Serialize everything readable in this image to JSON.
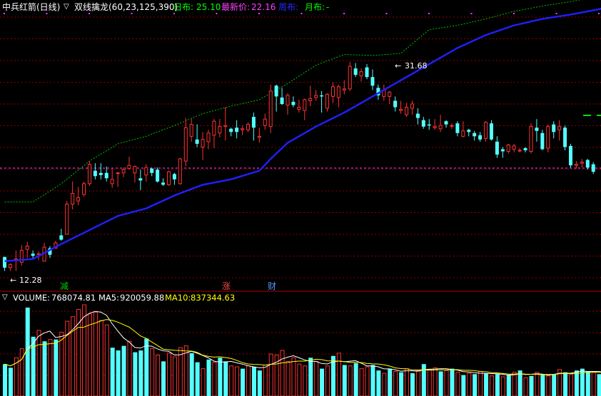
{
  "header": {
    "stock_name": "中兵红箭",
    "period": "(日线)",
    "indicator_icon": "chevron-down-icon",
    "indicator_name": "双线擒龙(60,23,125,390)",
    "day_label": "日布:",
    "day_value": "25.10",
    "latest_label": "最新价:",
    "latest_value": "22.16",
    "week_label": "周布:",
    "month_label": "月布:",
    "month_value": "-"
  },
  "annotations": {
    "high_price": "31.68",
    "low_price": "12.28",
    "high_arrow": "←",
    "low_arrow": "←"
  },
  "signals": [
    {
      "text": "减",
      "color": "#00cc00",
      "bar": 13
    },
    {
      "text": "涨",
      "color": "#ff4444",
      "bar": 47
    },
    {
      "text": "财",
      "color": "#5599ff",
      "bar": 57
    }
  ],
  "volume_header": {
    "icon": "chevron-down-icon",
    "volume_label": "VOLUME:",
    "volume_value": "768074.81",
    "ma5_label": "MA5:",
    "ma5_value": "920059.88",
    "ma10_label": "MA10:",
    "ma10_value": "837344.63"
  },
  "colors": {
    "up": "#ff3232",
    "down": "#54ffff",
    "blue_line": "#2020ff",
    "green_line": "#00c000",
    "ma5": "#ffffff",
    "ma10": "#ffff00",
    "grid": "#8b0000",
    "day_color": "#00ff00",
    "latest_color": "#ff40ff",
    "week_color": "#2020ff",
    "month_color": "#00ff00"
  },
  "chart_data": {
    "type": "candlestick",
    "price_range": [
      11.0,
      36.0
    ],
    "annotated_high": 31.68,
    "annotated_low": 12.28,
    "ohlc": [
      [
        13.6,
        13.0,
        12.3,
        12.6
      ],
      [
        12.6,
        13.0,
        12.3,
        12.9
      ],
      [
        13.4,
        14.2,
        12.3,
        13.4
      ],
      [
        13.1,
        14.7,
        12.8,
        14.2
      ],
      [
        14.3,
        15.0,
        13.5,
        14.6
      ],
      [
        13.9,
        14.2,
        13.4,
        13.7
      ],
      [
        13.8,
        14.1,
        13.3,
        13.9
      ],
      [
        13.2,
        14.9,
        13.2,
        14.5
      ],
      [
        14.4,
        14.6,
        13.5,
        13.8
      ],
      [
        14.4,
        15.1,
        14.4,
        14.9
      ],
      [
        15.6,
        16.2,
        15.1,
        15.2
      ],
      [
        15.7,
        18.8,
        15.7,
        18.5
      ],
      [
        18.5,
        20.6,
        18.0,
        19.5
      ],
      [
        18.8,
        20.1,
        18.4,
        19.1
      ],
      [
        19.4,
        20.6,
        19.2,
        20.4
      ],
      [
        20.4,
        22.5,
        20.2,
        22.2
      ],
      [
        21.6,
        22.3,
        20.8,
        21.1
      ],
      [
        21.4,
        22.3,
        20.8,
        21.2
      ],
      [
        21.4,
        22.0,
        20.6,
        20.9
      ],
      [
        20.4,
        21.8,
        20.0,
        20.8
      ],
      [
        21.4,
        21.5,
        20.1,
        21.4
      ],
      [
        21.4,
        21.9,
        21.0,
        21.7
      ],
      [
        21.8,
        22.9,
        21.7,
        22.1
      ],
      [
        21.4,
        22.1,
        20.5,
        22.0
      ],
      [
        20.9,
        21.7,
        19.8,
        20.7
      ],
      [
        21.2,
        22.2,
        20.6,
        21.9
      ],
      [
        21.8,
        21.9,
        21.1,
        21.4
      ],
      [
        21.7,
        21.9,
        20.5,
        20.6
      ],
      [
        20.5,
        20.9,
        20.2,
        20.3
      ],
      [
        20.3,
        21.6,
        20.2,
        21.5
      ],
      [
        21.3,
        21.4,
        20.3,
        20.8
      ],
      [
        20.4,
        22.8,
        20.3,
        22.7
      ],
      [
        22.5,
        26.5,
        22.0,
        25.6
      ],
      [
        24.8,
        26.4,
        24.3,
        25.9
      ],
      [
        24.5,
        25.9,
        23.8,
        24.1
      ],
      [
        23.8,
        25.2,
        22.6,
        24.5
      ],
      [
        24.3,
        25.4,
        23.6,
        25.1
      ],
      [
        24.9,
        26.4,
        23.7,
        26.2
      ],
      [
        25.1,
        26.4,
        24.7,
        25.7
      ],
      [
        25.7,
        27.5,
        24.4,
        25.8
      ],
      [
        25.5,
        25.6,
        24.8,
        25.2
      ],
      [
        25.6,
        26.3,
        24.6,
        25.2
      ],
      [
        25.4,
        25.8,
        24.9,
        25.5
      ],
      [
        25.4,
        26.1,
        25.2,
        25.9
      ],
      [
        26.6,
        27.0,
        24.4,
        25.6
      ],
      [
        24.7,
        25.6,
        24.2,
        24.8
      ],
      [
        25.8,
        26.9,
        25.4,
        26.4
      ],
      [
        25.7,
        29.6,
        25.1,
        29.0
      ],
      [
        29.5,
        29.6,
        27.1,
        28.5
      ],
      [
        28.4,
        29.3,
        27.7,
        27.8
      ],
      [
        27.7,
        28.8,
        26.8,
        28.6
      ],
      [
        28.0,
        28.5,
        27.5,
        27.7
      ],
      [
        27.3,
        28.2,
        27.0,
        27.5
      ],
      [
        27.2,
        28.3,
        26.3,
        28.2
      ],
      [
        28.1,
        29.5,
        27.6,
        28.3
      ],
      [
        28.4,
        29.1,
        28.1,
        28.6
      ],
      [
        28.6,
        29.0,
        27.0,
        28.5
      ],
      [
        27.4,
        28.8,
        27.1,
        28.7
      ],
      [
        28.5,
        29.8,
        27.9,
        29.4
      ],
      [
        28.4,
        29.6,
        27.5,
        29.4
      ],
      [
        29.1,
        30.0,
        28.7,
        29.2
      ],
      [
        29.2,
        31.7,
        29.0,
        31.3
      ],
      [
        31.1,
        31.6,
        30.3,
        30.5
      ],
      [
        30.4,
        31.1,
        29.9,
        30.8
      ],
      [
        31.2,
        31.5,
        30.1,
        30.3
      ],
      [
        30.3,
        31.0,
        29.1,
        29.5
      ],
      [
        29.3,
        29.6,
        28.2,
        28.6
      ],
      [
        28.5,
        29.6,
        28.1,
        29.1
      ],
      [
        28.5,
        29.0,
        27.8,
        28.9
      ],
      [
        28.1,
        28.5,
        27.1,
        27.5
      ],
      [
        27.2,
        28.1,
        26.9,
        27.3
      ],
      [
        26.8,
        27.9,
        26.6,
        27.5
      ],
      [
        27.4,
        28.1,
        26.8,
        27.8
      ],
      [
        26.9,
        27.4,
        25.9,
        26.5
      ],
      [
        26.3,
        26.6,
        25.5,
        25.7
      ],
      [
        25.9,
        26.4,
        25.4,
        25.8
      ],
      [
        25.6,
        26.4,
        25.4,
        25.7
      ],
      [
        25.5,
        26.8,
        25.2,
        25.8
      ],
      [
        26.2,
        26.3,
        25.6,
        25.9
      ],
      [
        25.8,
        26.0,
        25.5,
        25.8
      ],
      [
        26.0,
        26.2,
        24.8,
        25.1
      ],
      [
        24.8,
        26.2,
        24.7,
        25.3
      ],
      [
        25.4,
        25.5,
        24.8,
        25.2
      ],
      [
        25.1,
        25.3,
        24.4,
        24.8
      ],
      [
        24.9,
        25.2,
        24.3,
        24.5
      ],
      [
        24.6,
        26.2,
        24.3,
        26.1
      ],
      [
        26.0,
        26.3,
        24.4,
        24.5
      ],
      [
        24.3,
        24.8,
        22.8,
        23.1
      ],
      [
        23.6,
        23.8,
        22.8,
        23.4
      ],
      [
        23.4,
        24.1,
        23.2,
        24.0
      ],
      [
        23.6,
        24.1,
        23.3,
        23.9
      ],
      [
        23.5,
        23.7,
        23.3,
        23.5
      ],
      [
        23.7,
        23.8,
        23.3,
        23.5
      ],
      [
        23.4,
        26.0,
        23.2,
        25.7
      ],
      [
        25.6,
        26.4,
        24.3,
        25.3
      ],
      [
        25.1,
        25.4,
        23.5,
        23.6
      ],
      [
        23.7,
        25.9,
        23.3,
        25.7
      ],
      [
        25.9,
        26.2,
        24.6,
        25.2
      ],
      [
        25.4,
        26.3,
        24.4,
        25.7
      ],
      [
        25.6,
        25.8,
        23.5,
        23.8
      ],
      [
        23.9,
        24.1,
        21.9,
        22.1
      ],
      [
        22.1,
        22.5,
        21.8,
        22.2
      ],
      [
        22.3,
        22.7,
        21.9,
        22.4
      ],
      [
        22.6,
        22.7,
        21.7,
        21.9
      ],
      [
        22.2,
        22.4,
        21.3,
        21.5
      ]
    ],
    "ma_line": [
      [
        0,
        13.2
      ],
      [
        5,
        13.4
      ],
      [
        10,
        14.8
      ],
      [
        15,
        16.1
      ],
      [
        20,
        17.4
      ],
      [
        25,
        18.1
      ],
      [
        30,
        19.3
      ],
      [
        35,
        20.3
      ],
      [
        40,
        20.8
      ],
      [
        45,
        21.6
      ],
      [
        47,
        22.7
      ],
      [
        50,
        24.2
      ],
      [
        55,
        25.7
      ],
      [
        60,
        27.0
      ],
      [
        65,
        28.5
      ],
      [
        70,
        30.0
      ],
      [
        75,
        31.5
      ],
      [
        80,
        33.0
      ],
      [
        85,
        34.2
      ],
      [
        90,
        35.1
      ],
      [
        95,
        35.7
      ],
      [
        100,
        36.1
      ],
      [
        105,
        36.6
      ],
      [
        110,
        37.3
      ],
      [
        115,
        38.6
      ],
      [
        120,
        39.6
      ],
      [
        123,
        40.1
      ]
    ],
    "upper_band": [
      [
        0,
        18.7
      ],
      [
        5,
        18.7
      ],
      [
        10,
        20.4
      ],
      [
        15,
        22.5
      ],
      [
        20,
        24.1
      ],
      [
        25,
        24.8
      ],
      [
        30,
        25.8
      ],
      [
        35,
        26.9
      ],
      [
        40,
        27.6
      ],
      [
        45,
        28.2
      ],
      [
        50,
        29.7
      ],
      [
        55,
        31.4
      ],
      [
        60,
        32.4
      ],
      [
        65,
        32.3
      ],
      [
        70,
        32.5
      ],
      [
        75,
        34.7
      ],
      [
        80,
        35.1
      ],
      [
        85,
        35.7
      ],
      [
        90,
        36.4
      ],
      [
        95,
        36.9
      ],
      [
        100,
        37.3
      ],
      [
        105,
        37.8
      ],
      [
        110,
        38.3
      ],
      [
        115,
        39.0
      ],
      [
        120,
        39.9
      ],
      [
        125,
        40.7
      ],
      [
        130,
        41.4
      ],
      [
        135,
        41.5
      ],
      [
        140,
        41.6
      ],
      [
        145,
        41.4
      ],
      [
        150,
        41.3
      ],
      [
        155,
        41.0
      ],
      [
        160,
        40.5
      ],
      [
        165,
        39.9
      ],
      [
        170,
        39.4
      ],
      [
        175,
        38.8
      ],
      [
        180,
        38.1
      ],
      [
        185,
        37.5
      ],
      [
        190,
        36.9
      ],
      [
        195,
        36.3
      ],
      [
        200,
        35.7
      ],
      [
        205,
        34.9
      ],
      [
        210,
        34.0
      ]
    ],
    "volume": [
      [
        0.35,
        "down"
      ],
      [
        0.31,
        "down"
      ],
      [
        0.42,
        "up"
      ],
      [
        0.52,
        "up"
      ],
      [
        0.97,
        "down"
      ],
      [
        0.65,
        "down"
      ],
      [
        0.72,
        "up"
      ],
      [
        0.6,
        "down"
      ],
      [
        0.62,
        "up"
      ],
      [
        0.62,
        "down"
      ],
      [
        0.7,
        "up"
      ],
      [
        0.82,
        "up"
      ],
      [
        0.87,
        "up"
      ],
      [
        0.95,
        "up"
      ],
      [
        1.0,
        "up"
      ],
      [
        0.9,
        "up"
      ],
      [
        0.92,
        "up"
      ],
      [
        0.83,
        "up"
      ],
      [
        0.78,
        "up"
      ],
      [
        0.53,
        "down"
      ],
      [
        0.5,
        "down"
      ],
      [
        0.55,
        "down"
      ],
      [
        0.6,
        "up"
      ],
      [
        0.48,
        "down"
      ],
      [
        0.5,
        "down"
      ],
      [
        0.63,
        "down"
      ],
      [
        0.52,
        "up"
      ],
      [
        0.45,
        "up"
      ],
      [
        0.38,
        "down"
      ],
      [
        0.47,
        "up"
      ],
      [
        0.43,
        "up"
      ],
      [
        0.53,
        "up"
      ],
      [
        0.55,
        "up"
      ],
      [
        0.47,
        "down"
      ],
      [
        0.37,
        "down"
      ],
      [
        0.3,
        "up"
      ],
      [
        0.4,
        "down"
      ],
      [
        0.37,
        "up"
      ],
      [
        0.42,
        "down"
      ],
      [
        0.38,
        "down"
      ],
      [
        0.33,
        "up"
      ],
      [
        0.32,
        "up"
      ],
      [
        0.3,
        "down"
      ],
      [
        0.33,
        "up"
      ],
      [
        0.32,
        "down"
      ],
      [
        0.28,
        "down"
      ],
      [
        0.34,
        "up"
      ],
      [
        0.46,
        "up"
      ],
      [
        0.45,
        "up"
      ],
      [
        0.5,
        "up"
      ],
      [
        0.38,
        "up"
      ],
      [
        0.42,
        "up"
      ],
      [
        0.35,
        "up"
      ],
      [
        0.33,
        "up"
      ],
      [
        0.42,
        "down"
      ],
      [
        0.38,
        "up"
      ],
      [
        0.3,
        "down"
      ],
      [
        0.33,
        "up"
      ],
      [
        0.44,
        "down"
      ],
      [
        0.47,
        "up"
      ],
      [
        0.34,
        "down"
      ],
      [
        0.33,
        "up"
      ],
      [
        0.36,
        "down"
      ],
      [
        0.3,
        "up"
      ],
      [
        0.32,
        "up"
      ],
      [
        0.34,
        "down"
      ],
      [
        0.28,
        "down"
      ],
      [
        0.25,
        "up"
      ],
      [
        0.3,
        "down"
      ],
      [
        0.27,
        "up"
      ],
      [
        0.26,
        "down"
      ],
      [
        0.3,
        "up"
      ],
      [
        0.25,
        "down"
      ],
      [
        0.28,
        "up"
      ],
      [
        0.35,
        "down"
      ],
      [
        0.29,
        "up"
      ],
      [
        0.31,
        "up"
      ],
      [
        0.27,
        "down"
      ],
      [
        0.28,
        "up"
      ],
      [
        0.3,
        "down"
      ],
      [
        0.26,
        "up"
      ],
      [
        0.23,
        "down"
      ],
      [
        0.25,
        "up"
      ],
      [
        0.24,
        "down"
      ],
      [
        0.27,
        "up"
      ],
      [
        0.25,
        "down"
      ],
      [
        0.22,
        "up"
      ],
      [
        0.24,
        "down"
      ],
      [
        0.21,
        "up"
      ],
      [
        0.23,
        "down"
      ],
      [
        0.26,
        "up"
      ],
      [
        0.28,
        "down"
      ],
      [
        0.2,
        "up"
      ],
      [
        0.22,
        "down"
      ],
      [
        0.26,
        "up"
      ],
      [
        0.24,
        "down"
      ],
      [
        0.22,
        "up"
      ],
      [
        0.24,
        "down"
      ],
      [
        0.29,
        "up"
      ],
      [
        0.26,
        "down"
      ],
      [
        0.24,
        "up"
      ],
      [
        0.28,
        "down"
      ],
      [
        0.3,
        "down"
      ],
      [
        0.27,
        "down"
      ],
      [
        0.26,
        "up"
      ],
      [
        0.24,
        "down"
      ],
      [
        0.22,
        "up"
      ]
    ]
  }
}
